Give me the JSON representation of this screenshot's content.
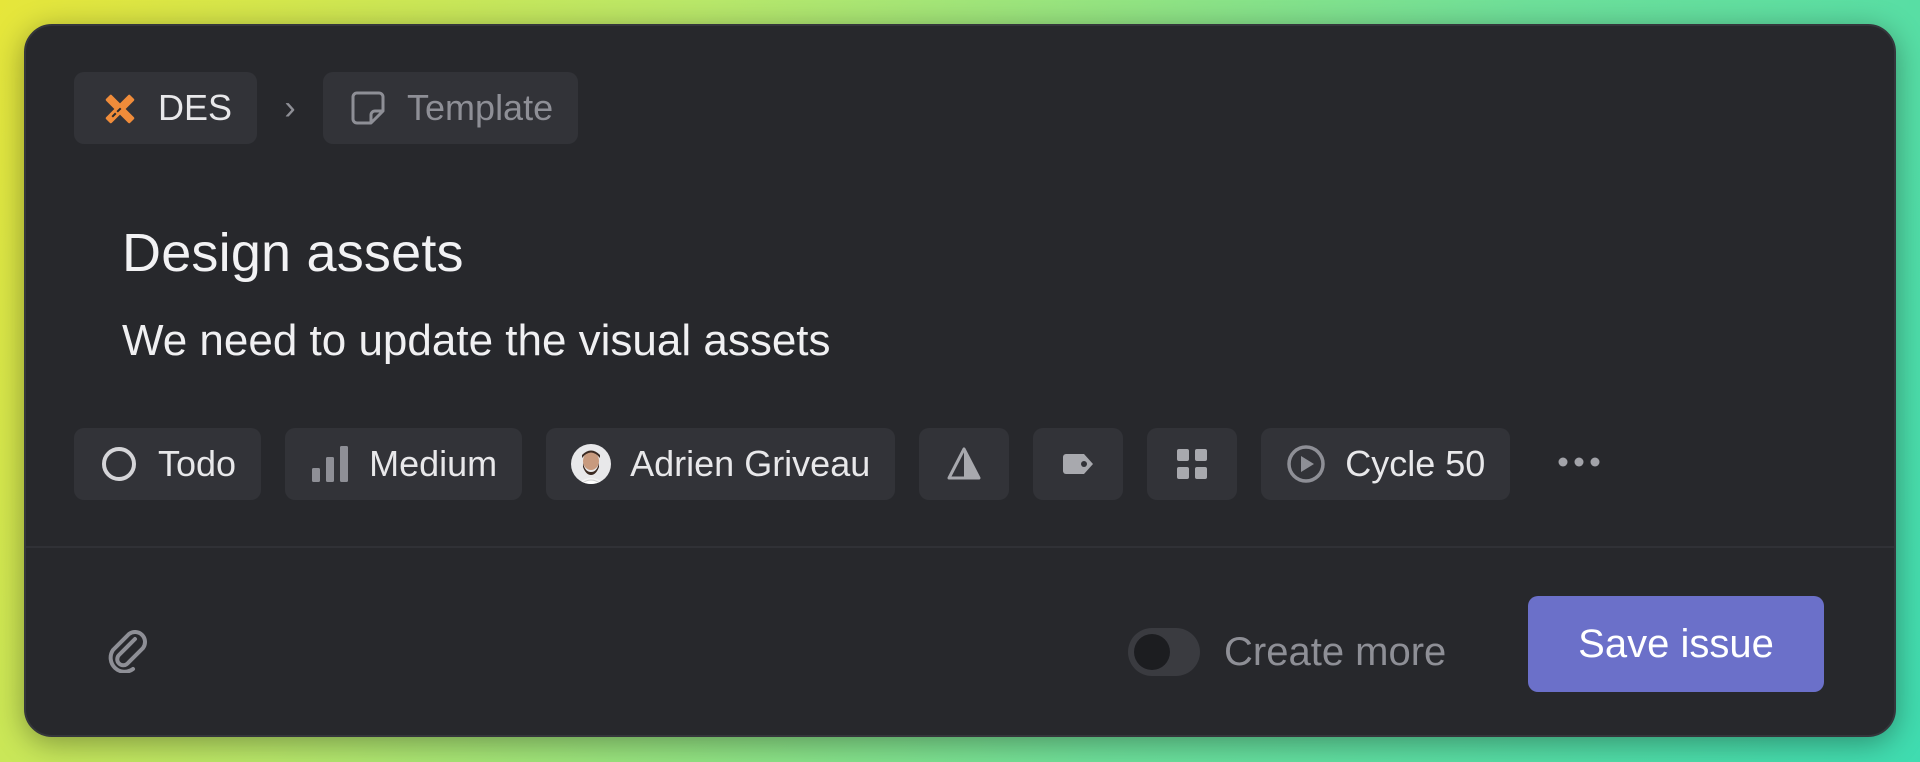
{
  "breadcrumb": {
    "team_label": "DES",
    "team_icon": "design-tools-icon",
    "separator": "›",
    "template_label": "Template",
    "template_icon": "note-icon"
  },
  "issue": {
    "title": "Design assets",
    "description": "We need to update the visual assets"
  },
  "properties": {
    "status": {
      "label": "Todo",
      "icon": "todo-circle-icon"
    },
    "priority": {
      "label": "Medium",
      "icon": "priority-bars-icon"
    },
    "assignee": {
      "label": "Adrien Griveau",
      "icon": "avatar"
    },
    "estimate": {
      "icon": "estimate-triangle-icon"
    },
    "labels": {
      "icon": "tag-icon"
    },
    "project": {
      "icon": "project-grid-icon"
    },
    "cycle": {
      "label": "Cycle 50",
      "icon": "cycle-play-icon"
    },
    "more": {
      "icon": "more-dots-icon"
    }
  },
  "footer": {
    "attach_icon": "paperclip-icon",
    "create_more_label": "Create more",
    "create_more_enabled": false,
    "save_label": "Save issue"
  },
  "colors": {
    "accent": "#6b70c9",
    "team_icon": "#f08c3a",
    "modal_bg": "#27282c",
    "chip_bg": "#323338"
  }
}
